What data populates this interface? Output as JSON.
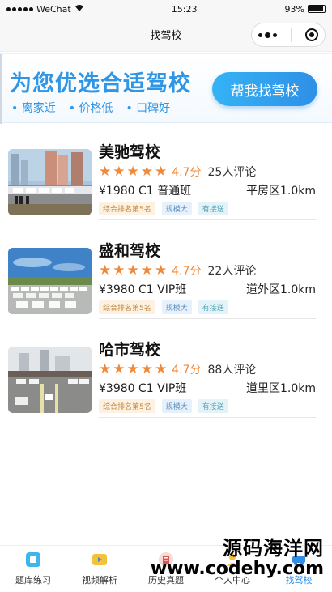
{
  "status_bar": {
    "carrier": "WeChat",
    "time": "15:23",
    "battery": "93%",
    "battery_level": 0.93
  },
  "nav": {
    "title": "找驾校"
  },
  "banner": {
    "headline": "为您优选合适驾校",
    "features": [
      "离家近",
      "价格低",
      "口碑好"
    ],
    "button_label": "帮我找驾校"
  },
  "schools": [
    {
      "name": "美驰驾校",
      "stars": 5,
      "score": "4.7分",
      "reviews": "25人评论",
      "price": "¥1980 C1 普通班",
      "location": "平房区1.0km",
      "tags": [
        "综合排名第5名",
        "规模大",
        "有接送"
      ],
      "thumb": "school-photo-1"
    },
    {
      "name": "盛和驾校",
      "stars": 5,
      "score": "4.7分",
      "reviews": "22人评论",
      "price": "¥3980 C1 VIP班",
      "location": "道外区1.0km",
      "tags": [
        "综合排名第5名",
        "规模大",
        "有接送"
      ],
      "thumb": "school-photo-2"
    },
    {
      "name": "哈市驾校",
      "stars": 5,
      "score": "4.7分",
      "reviews": "88人评论",
      "price": "¥3980 C1 VIP班",
      "location": "道里区1.0km",
      "tags": [
        "综合排名第5名",
        "规模大",
        "有接送"
      ],
      "thumb": "school-photo-3"
    }
  ],
  "tabs": [
    {
      "label": "题库练习",
      "icon": "question-bank-icon"
    },
    {
      "label": "视频解析",
      "icon": "video-icon"
    },
    {
      "label": "历史真题",
      "icon": "exam-history-icon"
    },
    {
      "label": "个人中心",
      "icon": "profile-icon"
    },
    {
      "label": "找驾校",
      "icon": "find-school-icon",
      "active": true
    }
  ],
  "watermark": {
    "title": "源码海洋网",
    "url": "www.codehy.com"
  },
  "colors": {
    "accent": "#2f8fe6",
    "star": "#ef8a3c"
  }
}
